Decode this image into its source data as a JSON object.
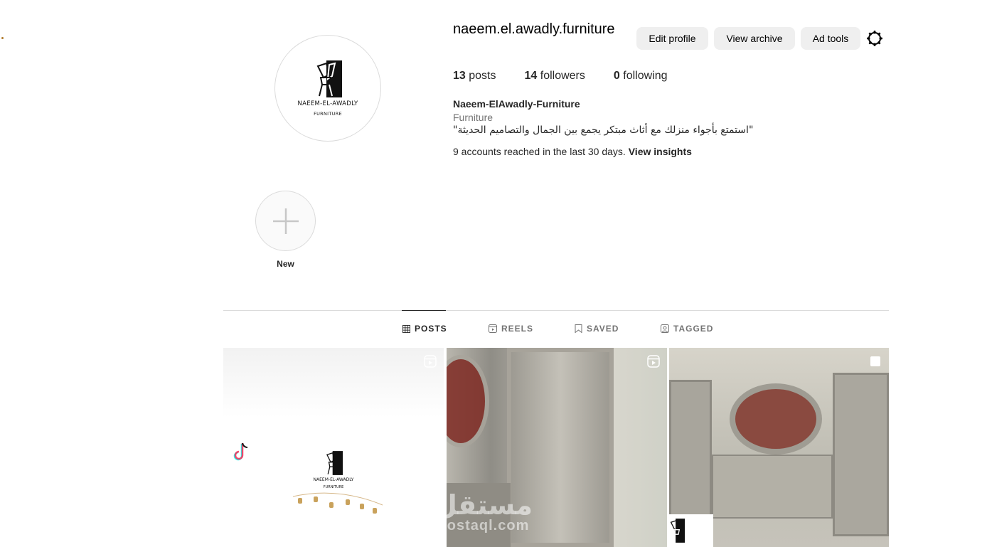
{
  "profile": {
    "username": "naeem.el.awadly.furniture",
    "logo_text": "NAEEM-EL-AWADLY",
    "logo_sub": "FURNITURE",
    "buttons": {
      "edit": "Edit profile",
      "archive": "View archive",
      "ad_tools": "Ad tools"
    },
    "stats": {
      "posts_count": "13",
      "posts_label": "posts",
      "followers_count": "14",
      "followers_label": "followers",
      "following_count": "0",
      "following_label": "following"
    },
    "bio": {
      "name": "Naeem-ElAwadly-Furniture",
      "category": "Furniture",
      "text": "\"استمتع بأجواء منزلك مع أثاث مبتكر يجمع بين الجمال والتصاميم الحديثة\""
    },
    "insights": {
      "text": "9 accounts reached in the last 30 days.",
      "link": "View insights"
    }
  },
  "highlights": {
    "new_label": "New"
  },
  "tabs": [
    {
      "label": "POSTS",
      "icon": "grid-icon",
      "active": true
    },
    {
      "label": "REELS",
      "icon": "reels-icon",
      "active": false
    },
    {
      "label": "SAVED",
      "icon": "bookmark-icon",
      "active": false
    },
    {
      "label": "TAGGED",
      "icon": "tagged-icon",
      "active": false
    }
  ],
  "posts": [
    {
      "type": "reel",
      "caption_logo": "NAEEM-EL-AWADLY",
      "caption_sub": "FURNITURE"
    },
    {
      "type": "reel"
    },
    {
      "type": "carousel"
    }
  ],
  "watermark": {
    "arabic": "مستقل",
    "latin": "mostaql.com"
  },
  "colors": {
    "button_bg": "#efefef",
    "secondary_text": "#737373",
    "divider": "#dbdbdb"
  }
}
